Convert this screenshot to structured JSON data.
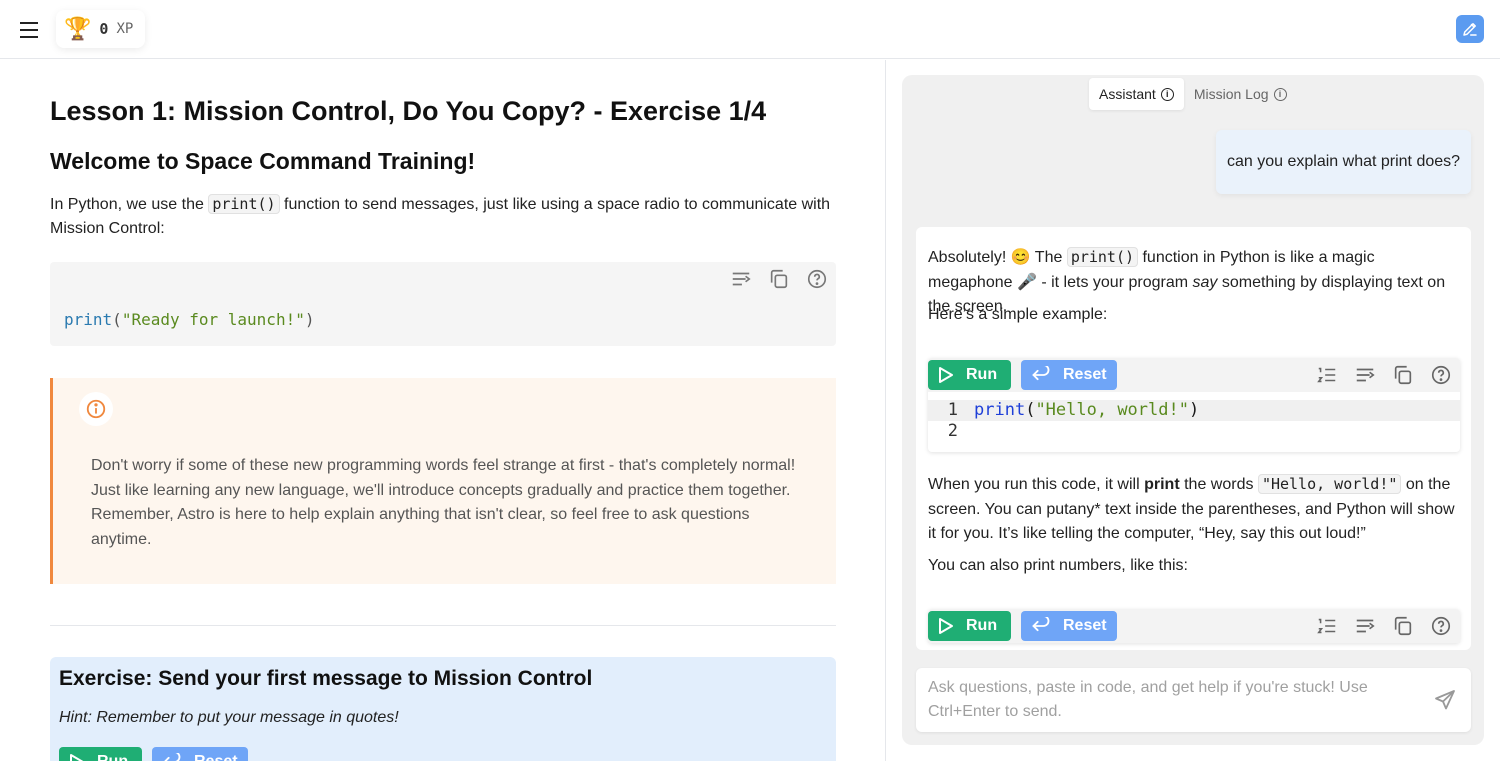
{
  "topbar": {
    "xp_value": "0",
    "xp_label": "XP"
  },
  "lesson": {
    "title": "Lesson 1: Mission Control, Do You Copy? - Exercise 1/4",
    "section_title": "Welcome to Space Command Training!",
    "intro_before": "In Python, we use the",
    "intro_code": "print()",
    "intro_after": "function to send messages, just like using a space radio to communicate with Mission Control:",
    "code_fn": "print",
    "code_open": "(",
    "code_str": "\"Ready for launch!\"",
    "code_close": ")",
    "callout_text": "Don't worry if some of these new programming words feel strange at first - that's completely normal! Just like learning any new language, we'll introduce concepts gradually and practice them together. Remember, Astro is here to help explain anything that isn't clear, so feel free to ask questions anytime."
  },
  "exercise": {
    "title": "Exercise: Send your first message to Mission Control",
    "hint": "Hint: Remember to put your message in quotes!",
    "run_label": "Run",
    "reset_label": "Reset"
  },
  "assistant": {
    "tabs": [
      {
        "label": "Assistant",
        "active": true
      },
      {
        "label": "Mission Log",
        "active": false
      }
    ],
    "user_message": "can you explain what print does?",
    "reply": {
      "p1_a": "Absolutely! 😊 The",
      "p1_code": "print()",
      "p1_b": "function in Python is like a magic megaphone 🎤 - it lets your program",
      "p1_em": "say",
      "p1_c": "something by displaying text on the screen.",
      "p2": "Here’s a simple example:",
      "code1_fn": "print",
      "code1_open": "(",
      "code1_str": "\"Hello, world!\"",
      "code1_close": ")",
      "line1": "1",
      "line2": "2",
      "p3_a": "When you run this code, it will",
      "p3_bold": "print",
      "p3_b": "the words",
      "p3_code": "\"Hello, world!\"",
      "p3_c": "on the screen. You can putany* text inside the parentheses, and Python will show it for you. It’s like telling the computer, “Hey, say this out loud!”",
      "p4": "You can also print numbers, like this:",
      "run_label": "Run",
      "reset_label": "Reset"
    },
    "input_placeholder": "Ask questions, paste in code, and get help if you're stuck! Use Ctrl+Enter to send."
  },
  "colors": {
    "run_green": "#1fae74",
    "reset_blue": "#6fa5f7",
    "callout_accent": "#f0883e",
    "exercise_bg": "#e2eefc"
  },
  "icons": [
    "menu-icon",
    "trophy-icon",
    "edit-icon",
    "wrap-icon",
    "copy-icon",
    "help-icon",
    "info-icon",
    "play-icon",
    "undo-icon",
    "line-numbers-icon",
    "send-icon"
  ]
}
